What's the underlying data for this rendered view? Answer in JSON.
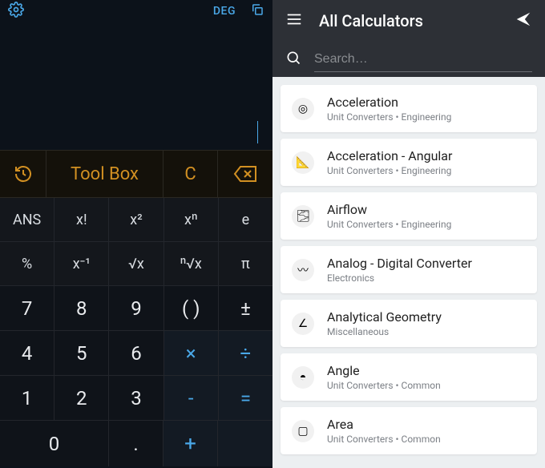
{
  "calc": {
    "deg": "DEG",
    "row1": {
      "toolbox": "Tool Box",
      "clear": "C"
    },
    "fn1": {
      "ans": "ANS",
      "fac": "x!",
      "sq": "x²",
      "pow": "xⁿ",
      "e": "e"
    },
    "fn2": {
      "pct": "%",
      "inv": "x⁻¹",
      "sqrt": "√x",
      "nroot": "ⁿ√x",
      "pi": "π"
    },
    "n": {
      "7": "7",
      "8": "8",
      "9": "9",
      "paren": "( )",
      "pm": "±",
      "4": "4",
      "5": "5",
      "6": "6",
      "mul": "×",
      "div": "÷",
      "1": "1",
      "2": "2",
      "3": "3",
      "sub": "-",
      "eq": "=",
      "0": "0",
      "dot": ".",
      "add": "+"
    }
  },
  "list": {
    "title": "All Calculators",
    "searchPlaceholder": "Search…",
    "items": [
      {
        "icon": "◎",
        "title": "Acceleration",
        "subtitle": "Unit Converters • Engineering"
      },
      {
        "icon": "📐",
        "title": "Acceleration - Angular",
        "subtitle": "Unit Converters • Engineering"
      },
      {
        "icon": "🌫",
        "title": "Airflow",
        "subtitle": "Unit Converters • Engineering"
      },
      {
        "icon": "〰",
        "title": "Analog - Digital Converter",
        "subtitle": "Electronics"
      },
      {
        "icon": "∠",
        "title": "Analytical Geometry",
        "subtitle": "Miscellaneous"
      },
      {
        "icon": "◓",
        "title": "Angle",
        "subtitle": "Unit Converters • Common"
      },
      {
        "icon": "▢",
        "title": "Area",
        "subtitle": "Unit Converters • Common"
      }
    ]
  }
}
